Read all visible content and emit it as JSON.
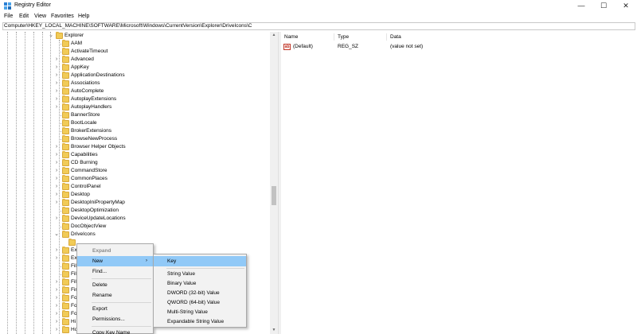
{
  "window": {
    "title": "Registry Editor",
    "minimize_glyph": "—",
    "maximize_glyph": "☐",
    "close_glyph": "✕"
  },
  "menubar": [
    "File",
    "Edit",
    "View",
    "Favorites",
    "Help"
  ],
  "address": "Computer\\HKEY_LOCAL_MACHINE\\SOFTWARE\\Microsoft\\Windows\\CurrentVersion\\Explorer\\DriveIcons\\C",
  "tree": {
    "root": "Explorer",
    "children": [
      {
        "label": "AAM",
        "expandable": false
      },
      {
        "label": "ActivateTimeout",
        "expandable": false
      },
      {
        "label": "Advanced",
        "expandable": true
      },
      {
        "label": "AppKey",
        "expandable": true
      },
      {
        "label": "ApplicationDestinations",
        "expandable": true
      },
      {
        "label": "Associations",
        "expandable": true
      },
      {
        "label": "AutoComplete",
        "expandable": true
      },
      {
        "label": "AutoplayExtensions",
        "expandable": true
      },
      {
        "label": "AutoplayHandlers",
        "expandable": true
      },
      {
        "label": "BannerStore",
        "expandable": false
      },
      {
        "label": "BootLocale",
        "expandable": false
      },
      {
        "label": "BrokerExtensions",
        "expandable": false
      },
      {
        "label": "BrowseNewProcess",
        "expandable": false
      },
      {
        "label": "Browser Helper Objects",
        "expandable": true
      },
      {
        "label": "Capabilities",
        "expandable": true
      },
      {
        "label": "CD Burning",
        "expandable": true
      },
      {
        "label": "CommandStore",
        "expandable": true
      },
      {
        "label": "CommonPlaces",
        "expandable": true
      },
      {
        "label": "ControlPanel",
        "expandable": true
      },
      {
        "label": "Desktop",
        "expandable": true
      },
      {
        "label": "DesktopIniPropertyMap",
        "expandable": true
      },
      {
        "label": "DesktopOptimization",
        "expandable": false
      },
      {
        "label": "DeviceUpdateLocations",
        "expandable": true
      },
      {
        "label": "DocObjectView",
        "expandable": false
      },
      {
        "label": "DriveIcons",
        "expandable": true,
        "expanded": true
      }
    ],
    "selected_child": "C",
    "partial_labels": [
      "Ex",
      "Ext",
      "Fil",
      "Fil",
      "Fil",
      "Fin",
      "Fo",
      "Fo",
      "Fo",
      "Hi",
      "Ho"
    ]
  },
  "values_pane": {
    "columns": [
      "Name",
      "Type",
      "Data"
    ],
    "rows": [
      {
        "icon": "ab",
        "name": "(Default)",
        "type": "REG_SZ",
        "data": "(value not set)"
      }
    ]
  },
  "context_menu": {
    "items": [
      "Expand",
      "New",
      "Find...",
      "Delete",
      "Rename",
      "Export",
      "Permissions...",
      "Copy Key Name"
    ],
    "submenu_arrow": "›"
  },
  "new_submenu": {
    "items": [
      "Key",
      "String Value",
      "Binary Value",
      "DWORD (32-bit) Value",
      "QWORD (64-bit) Value",
      "Multi-String Value",
      "Expandable String Value"
    ]
  },
  "colors": {
    "highlight": "#91c9f7",
    "folder": "#f1cb57",
    "selected_row": "#cce8ff"
  }
}
